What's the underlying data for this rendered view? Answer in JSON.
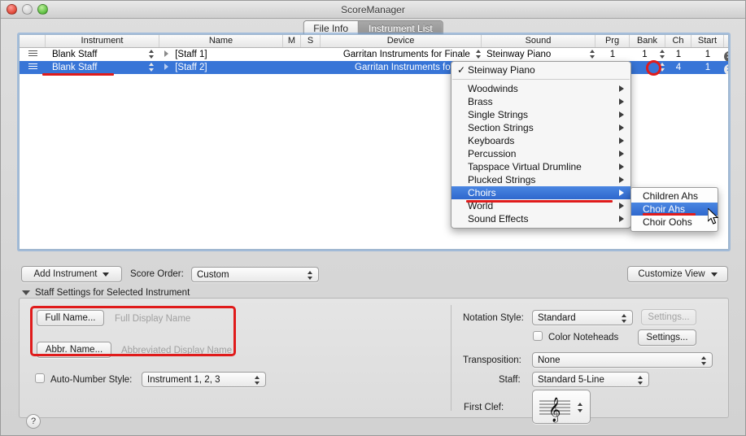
{
  "window": {
    "title": "ScoreManager",
    "traffic_lights": [
      "close-button",
      "minimize-button",
      "zoom-button"
    ]
  },
  "tabs": [
    {
      "label": "File Info",
      "active": false
    },
    {
      "label": "Instrument List",
      "active": true
    }
  ],
  "table": {
    "columns": [
      "",
      "Instrument",
      "Name",
      "M",
      "S",
      "Device",
      "Sound",
      "Prg",
      "Bank",
      "Ch",
      "Start",
      ""
    ],
    "rows": [
      {
        "instrument": "Blank Staff",
        "name": "[Staff 1]",
        "device": "Garritan Instruments for Finale",
        "sound": "Steinway Piano",
        "prg": "1",
        "bank": "1",
        "ch": "1",
        "start": "1",
        "selected": false
      },
      {
        "instrument": "Blank Staff",
        "name": "[Staff 2]",
        "device": "Garritan Instruments for Finale",
        "sound": "Steinway Piano",
        "prg": "",
        "bank": "",
        "ch": "4",
        "start": "1",
        "selected": true
      }
    ]
  },
  "sound_menu": {
    "checked_item": "Steinway Piano",
    "check_glyph": "✓",
    "items": [
      "Woodwinds",
      "Brass",
      "Single Strings",
      "Section Strings",
      "Keyboards",
      "Percussion",
      "Tapspace Virtual Drumline",
      "Plucked Strings",
      "Choirs",
      "World",
      "Sound Effects"
    ],
    "highlighted": "Choirs"
  },
  "sound_submenu": {
    "items": [
      "Children Ahs",
      "Choir Ahs",
      "Choir Oohs"
    ],
    "highlighted": "Choir Ahs"
  },
  "toolbar": {
    "add_instrument": "Add Instrument",
    "score_order_label": "Score Order:",
    "score_order_value": "Custom",
    "customize_view": "Customize View"
  },
  "staff_settings": {
    "disclosure_title": "Staff Settings for Selected Instrument",
    "full_name_button": "Full Name...",
    "full_name_placeholder": "Full Display Name",
    "abbr_name_button": "Abbr. Name...",
    "abbr_name_placeholder": "Abbreviated Display Name",
    "auto_number_label": "Auto-Number Style:",
    "auto_number_value": "Instrument 1, 2, 3",
    "notation_style_label": "Notation Style:",
    "notation_style_value": "Standard",
    "notation_settings_button": "Settings...",
    "color_noteheads_label": "Color Noteheads",
    "color_noteheads_settings_button": "Settings...",
    "transposition_label": "Transposition:",
    "transposition_value": "None",
    "staff_label": "Staff:",
    "staff_value": "Standard 5-Line",
    "first_clef_label": "First Clef:",
    "first_clef_glyph": "𝄞"
  },
  "help": {
    "label": "?"
  },
  "colors": {
    "selection_blue": "#3875d7",
    "menu_highlight": "#2f68cd",
    "annotation_red": "#e01b1b",
    "window_bg": "#d8d8d8"
  }
}
